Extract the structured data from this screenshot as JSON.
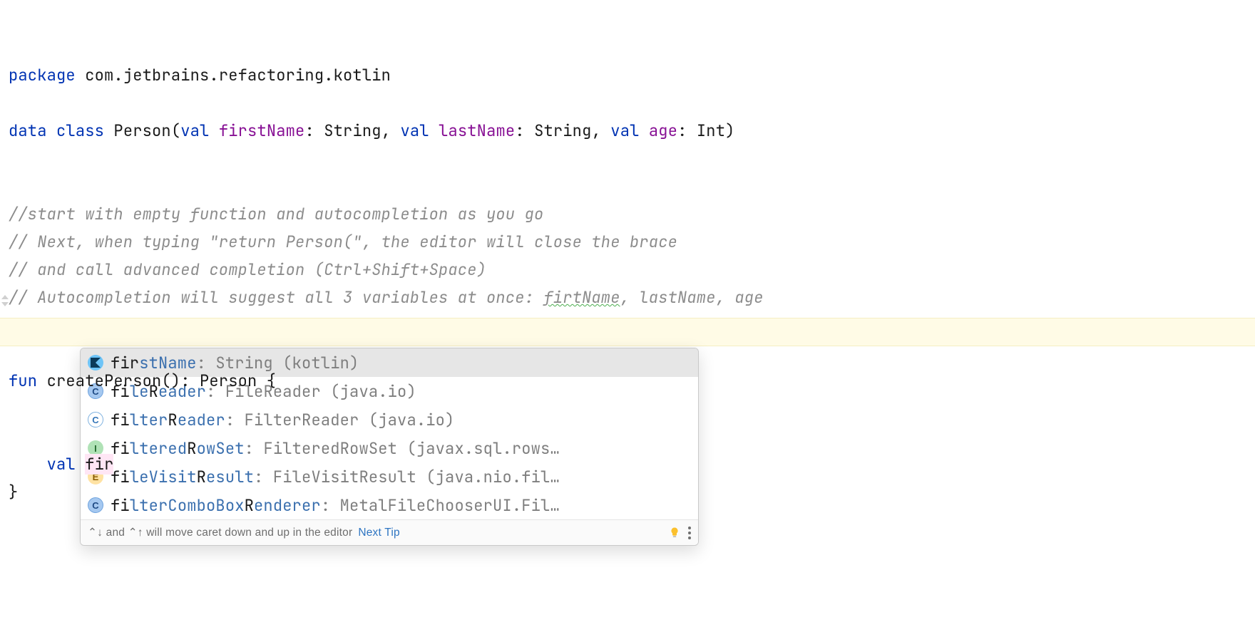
{
  "code": {
    "package_kw": "package",
    "package_name": " com.jetbrains.refactoring.kotlin",
    "data_kw": "data ",
    "class_kw": "class",
    "person": " Person(",
    "val_kw": "val",
    "firstName": " firstName",
    "colon_string": ": String, ",
    "lastName": " lastName",
    "age": " age",
    "colon_int": ": Int)",
    "cmt1": "//start with empty function and autocompletion as you go",
    "cmt2": "// Next, when typing \"return Person(\", the editor will close the brace",
    "cmt3": "// and call advanced completion (Ctrl+Shift+Space)",
    "cmt4_pre": "// Autocompletion will suggest all 3 variables at once: ",
    "cmt4_wavy": "firtName",
    "cmt4_post": ", lastName, age",
    "fun_kw": "fun",
    "fn_sig": " createPerson(): Person {",
    "active_pre": "    ",
    "fir": "fir",
    "close_brace": "}"
  },
  "popup": {
    "items": [
      {
        "icon": "kt",
        "match": "fir",
        "rest": "stName",
        "tail": ": String (kotlin)"
      },
      {
        "icon": "c",
        "match": "fi",
        "mid": "le",
        "b2": "R",
        "rest": "eader",
        "tail": ": FileReader (java.io)"
      },
      {
        "icon": "ch",
        "match": "fi",
        "mid": "lter",
        "b2": "R",
        "rest": "eader",
        "tail": ": FilterReader (java.io)"
      },
      {
        "icon": "i",
        "match": "fi",
        "mid": "ltered",
        "b2": "R",
        "rest": "owSet",
        "tail": ": FilteredRowSet (javax.sql.rows…"
      },
      {
        "icon": "e",
        "match": "fi",
        "mid": "leVisit",
        "b2": "R",
        "rest": "esult",
        "tail": ": FileVisitResult (java.nio.fil…"
      },
      {
        "icon": "c",
        "match": "fi",
        "mid": "lterComboBox",
        "b2": "R",
        "rest": "enderer",
        "tail": ": MetalFileChooserUI.Fil…"
      }
    ],
    "hint_pre": "⌃↓ and ⌃↑ will move caret down and up in the editor",
    "next_tip": "Next Tip"
  }
}
